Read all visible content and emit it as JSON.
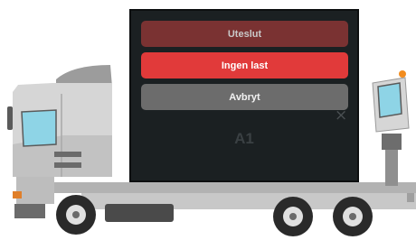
{
  "modal": {
    "buttons": {
      "exclude_label": "Uteslut",
      "no_load_label": "Ingen last",
      "cancel_label": "Avbryt"
    },
    "background_label": "A1",
    "close_glyph": "×"
  },
  "colors": {
    "modal_bg": "#1b2022",
    "exclude_button": "#7a3232",
    "no_load_button": "#e13a3a",
    "cancel_button": "#6c6c6c",
    "truck_body": "#d4d4d4",
    "beacon": "#f28c1e"
  },
  "icons": {
    "close": "close-icon",
    "beacon": "beacon-icon"
  }
}
